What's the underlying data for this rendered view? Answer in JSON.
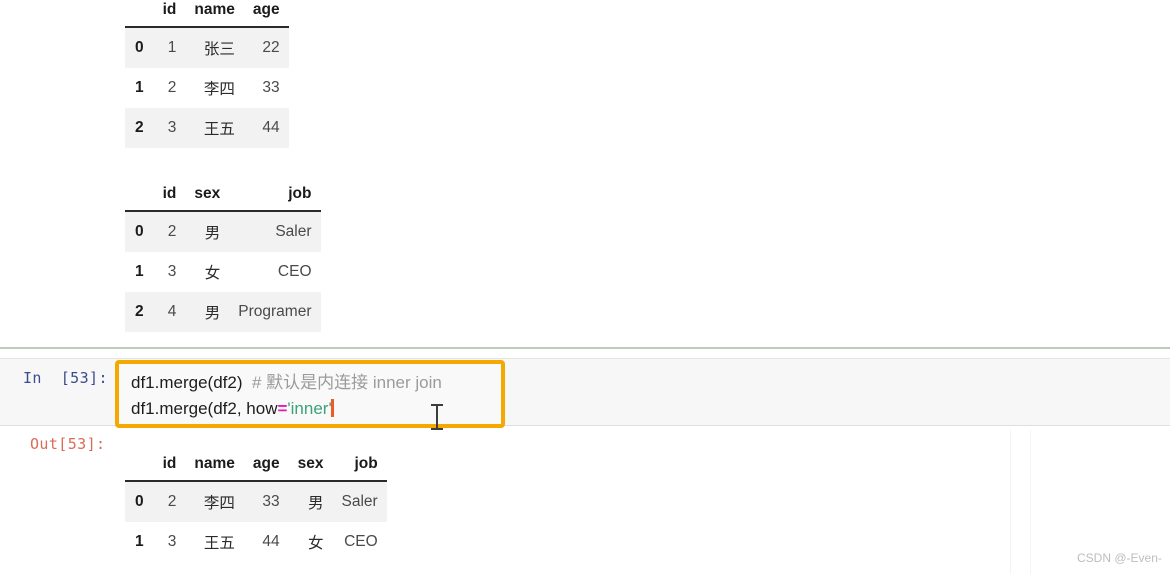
{
  "tables": [
    {
      "name": "df1-table",
      "columns": [
        "id",
        "name",
        "age"
      ],
      "index": [
        "0",
        "1",
        "2"
      ],
      "rows": [
        [
          "1",
          "张三",
          "22"
        ],
        [
          "2",
          "李四",
          "33"
        ],
        [
          "3",
          "王五",
          "44"
        ]
      ]
    },
    {
      "name": "df2-table",
      "columns": [
        "id",
        "sex",
        "job"
      ],
      "index": [
        "0",
        "1",
        "2"
      ],
      "rows": [
        [
          "2",
          "男",
          "Saler"
        ],
        [
          "3",
          "女",
          "CEO"
        ],
        [
          "4",
          "男",
          "Programer"
        ]
      ]
    },
    {
      "name": "merge-output-table",
      "columns": [
        "id",
        "name",
        "age",
        "sex",
        "job"
      ],
      "index": [
        "0",
        "1"
      ],
      "rows": [
        [
          "2",
          "李四",
          "33",
          "男",
          "Saler"
        ],
        [
          "3",
          "王五",
          "44",
          "女",
          "CEO"
        ]
      ]
    }
  ],
  "cell": {
    "in_prompt": "In  [53]:",
    "out_prompt": "Out[53]:",
    "code_line1_call": "df1.merge(df2)",
    "code_line1_comment": "# 默认是内连接 inner join",
    "code_line2_prefix": "df1.merge(df2, how",
    "code_line2_op": "=",
    "code_line2_string": "'inner'",
    "highlight_color": "#f5a800",
    "caret_color": "#f05a28"
  },
  "watermark": {
    "text": "CSDN @-Even-"
  }
}
